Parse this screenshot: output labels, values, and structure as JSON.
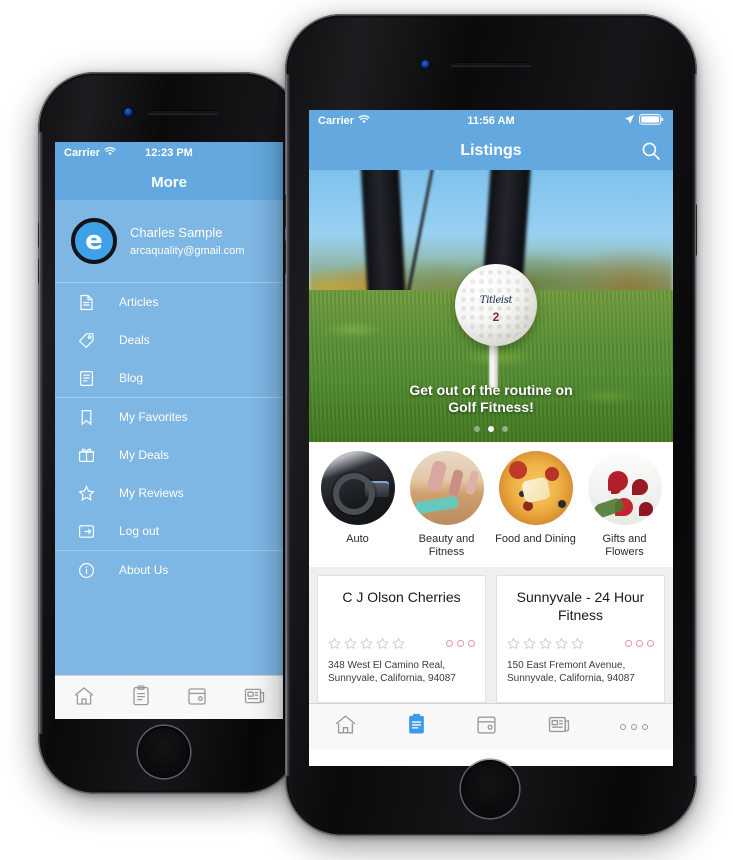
{
  "left_phone": {
    "status_bar": {
      "carrier": "Carrier",
      "wifi_icon": "wifi-icon",
      "time": "12:23 PM"
    },
    "navbar": {
      "title": "More"
    },
    "profile": {
      "avatar_letter": "e",
      "name": "Charles Sample",
      "email": "arcaquality@gmail.com"
    },
    "menu_groups": [
      {
        "items": [
          {
            "label": "Articles",
            "icon": "document-icon"
          },
          {
            "label": "Deals",
            "icon": "tag-icon"
          },
          {
            "label": "Blog",
            "icon": "blog-list-icon"
          }
        ]
      },
      {
        "items": [
          {
            "label": "My Favorites",
            "icon": "bookmark-icon"
          },
          {
            "label": "My Deals",
            "icon": "gift-icon"
          },
          {
            "label": "My Reviews",
            "icon": "star-outline-icon"
          },
          {
            "label": "Log out",
            "icon": "logout-icon"
          }
        ]
      },
      {
        "items": [
          {
            "label": "About Us",
            "icon": "info-circle-icon"
          }
        ]
      }
    ],
    "tabbar": [
      {
        "icon": "home-icon",
        "active": false
      },
      {
        "icon": "clipboard-icon",
        "active": false
      },
      {
        "icon": "calendar-icon",
        "active": false
      },
      {
        "icon": "news-icon",
        "active": false
      }
    ]
  },
  "right_phone": {
    "status_bar": {
      "carrier": "Carrier",
      "wifi_icon": "wifi-icon",
      "time": "11:56 AM",
      "location_icon": "location-arrow-icon",
      "battery_icon": "battery-full-icon"
    },
    "navbar": {
      "title": "Listings",
      "search_icon": "search-icon"
    },
    "hero": {
      "image_alt": "golf-ball-on-tee",
      "ball_brand": "Titleist",
      "ball_number": "2",
      "caption_line1": "Get out of the routine on",
      "caption_line2": "Golf Fitness!",
      "dots_total": 3,
      "dots_active_index": 1
    },
    "categories": [
      {
        "label": "Auto",
        "image": "car-interior"
      },
      {
        "label": "Beauty and Fitness",
        "image": "yoga-class"
      },
      {
        "label": "Food and Dining",
        "image": "pizza"
      },
      {
        "label": "Gifts and Flowers",
        "image": "red-roses-bouquet"
      }
    ],
    "listings": [
      {
        "title": "C J Olson Cherries",
        "stars": 5,
        "stars_filled": 0,
        "price_dots": 3,
        "address_line1": "348 West El Camino Real,",
        "address_line2": "Sunnyvale, California, 94087"
      },
      {
        "title": "Sunnyvale - 24 Hour Fitness",
        "stars": 5,
        "stars_filled": 0,
        "price_dots": 3,
        "address_line1": "150 East Fremont Avenue,",
        "address_line2": "Sunnyvale, California, 94087"
      }
    ],
    "tabbar": [
      {
        "icon": "home-icon",
        "active": false
      },
      {
        "icon": "clipboard-icon",
        "active": true
      },
      {
        "icon": "calendar-icon",
        "active": false
      },
      {
        "icon": "news-icon",
        "active": false
      },
      {
        "icon": "more-dots-icon",
        "active": false
      }
    ]
  },
  "colors": {
    "header_blue": "#63A8DE",
    "menu_blue": "#7EB6E4",
    "accent_blue": "#3FA2E8",
    "tab_active": "#3C9BE8",
    "card_bg": "#FFFFFF",
    "page_bg": "#EFEFF1"
  }
}
